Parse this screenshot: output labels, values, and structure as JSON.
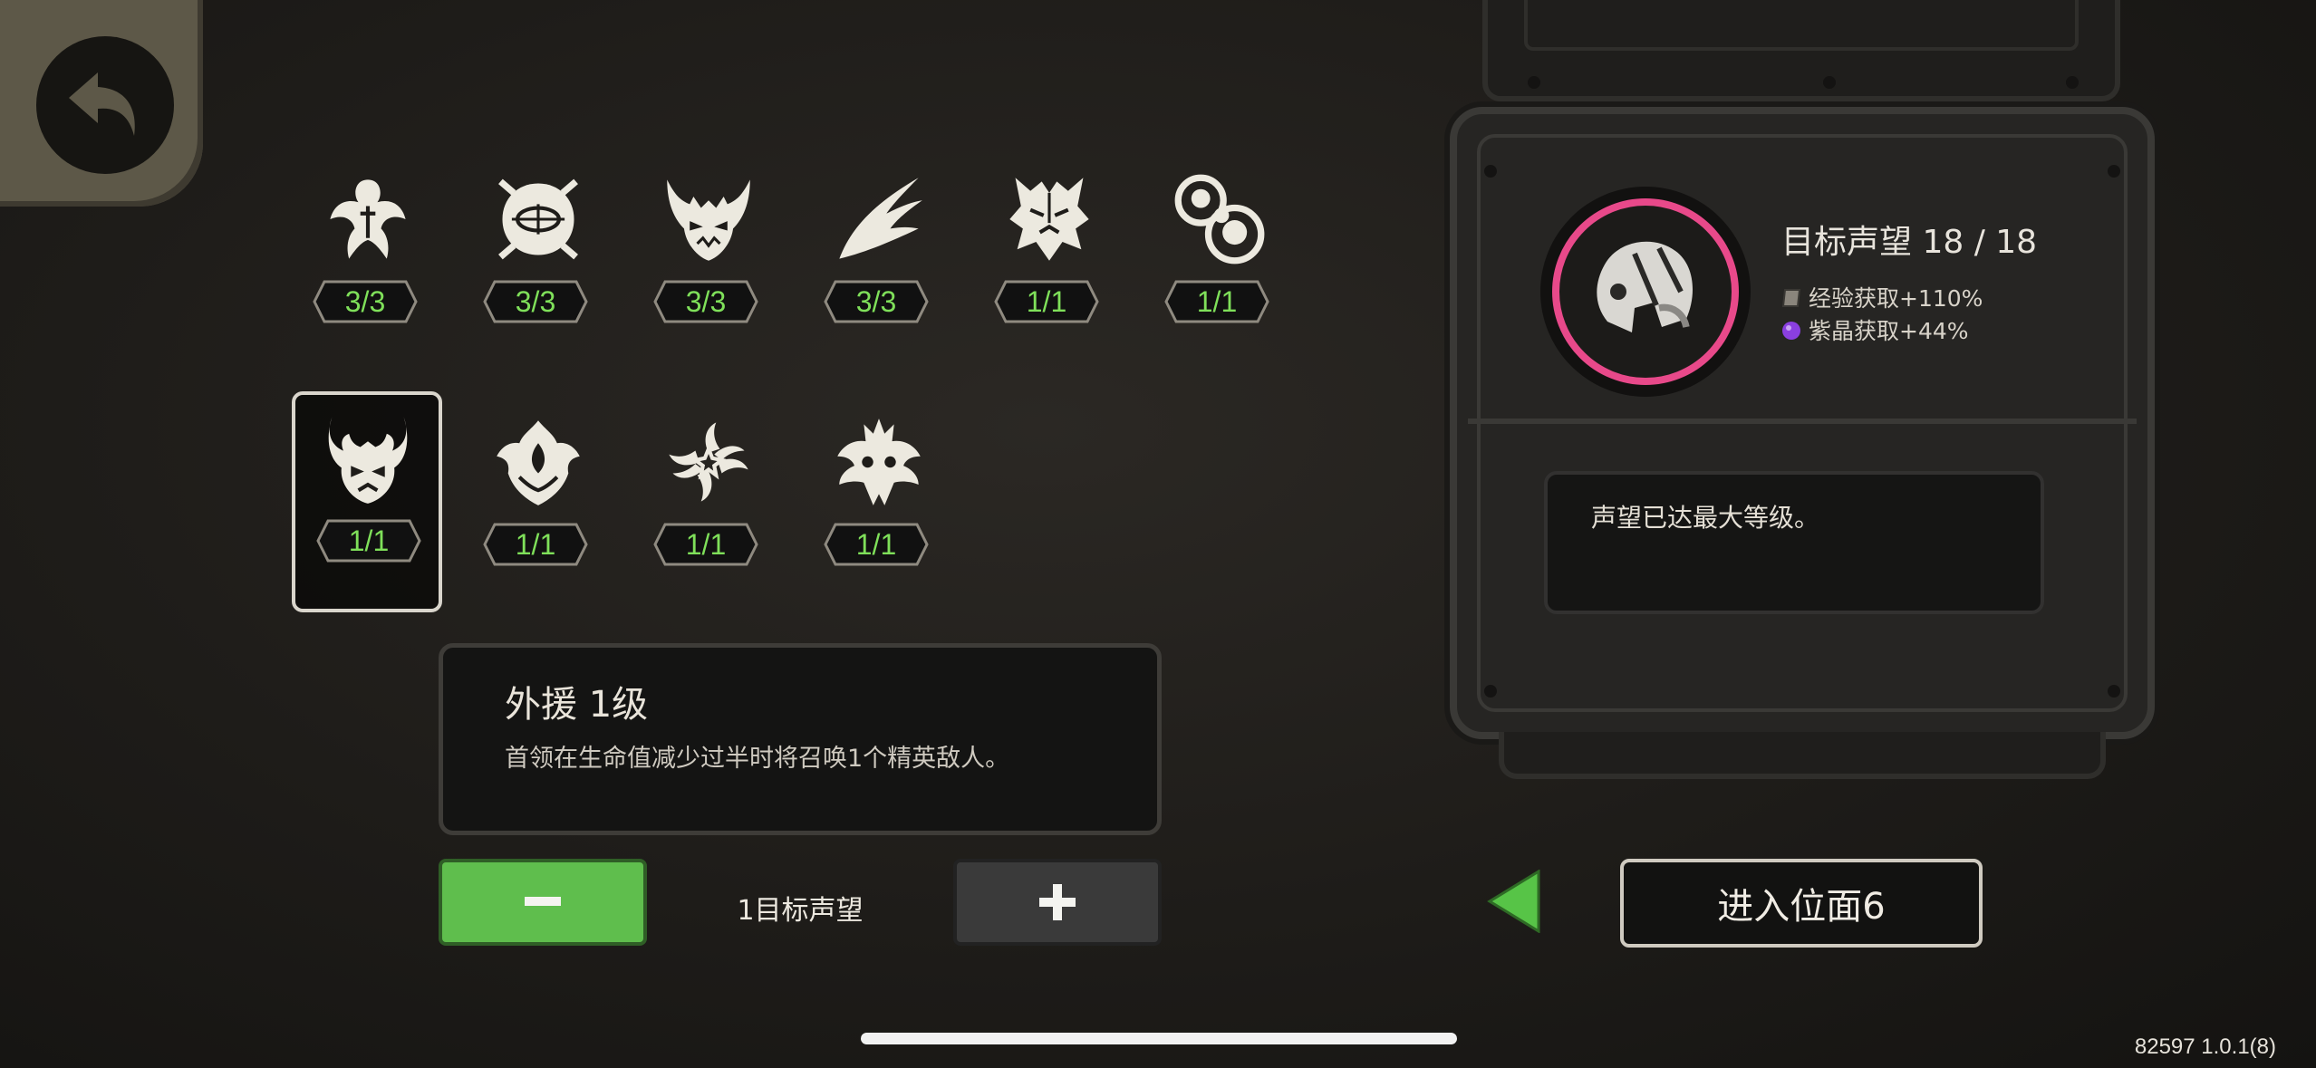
{
  "modifiers": [
    {
      "icon": "hand-claw-icon",
      "count": "3/3"
    },
    {
      "icon": "sealed-orb-icon",
      "count": "3/3"
    },
    {
      "icon": "demon-mask-icon",
      "count": "3/3"
    },
    {
      "icon": "comet-icon",
      "count": "3/3"
    },
    {
      "icon": "totem-face-icon",
      "count": "1/1"
    },
    {
      "icon": "bubbles-icon",
      "count": "1/1"
    },
    {
      "icon": "horned-demon-icon",
      "count": "1/1",
      "selected": true
    },
    {
      "icon": "flame-crest-icon",
      "count": "1/1"
    },
    {
      "icon": "swirl-star-icon",
      "count": "1/1"
    },
    {
      "icon": "spiked-star-icon",
      "count": "1/1"
    }
  ],
  "detail": {
    "title": "外援 1级",
    "description": "首领在生命值减少过半时将召唤1个精英敌人。"
  },
  "controls": {
    "reputation_cost": "1目标声望"
  },
  "reputation": {
    "title": "目标声望 18 / 18",
    "exp_bonus": "经验获取+110%",
    "crystal_bonus": "紫晶获取+44%",
    "message": "声望已达最大等级。"
  },
  "enter_button": "进入位面6",
  "version": "82597 1.0.1(8)",
  "colors": {
    "count_green": "#7fe05a",
    "minus_button": "#5fbe4d",
    "avatar_ring": "#e8498a",
    "crystal_purple": "#8a3fe0"
  }
}
